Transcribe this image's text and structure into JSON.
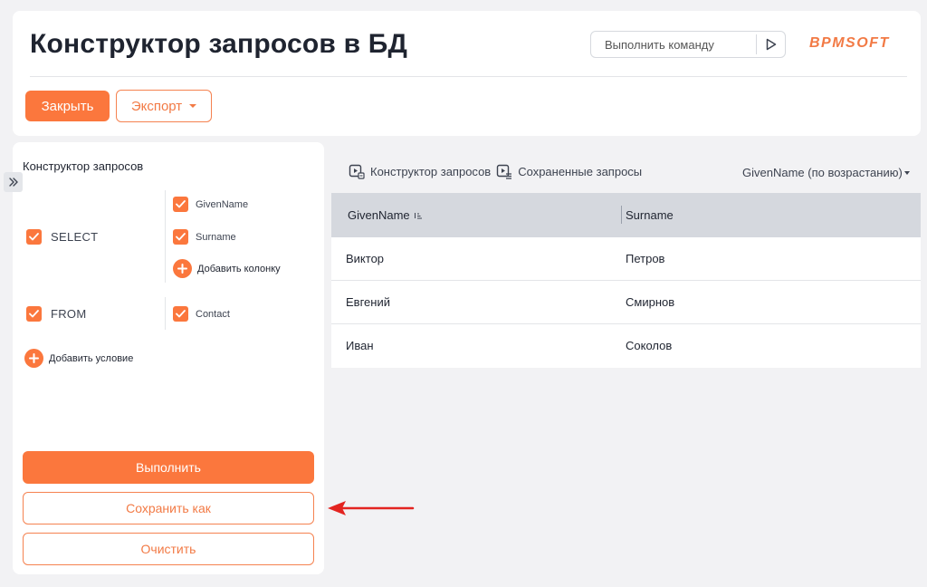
{
  "header": {
    "title": "Конструктор запросов в БД",
    "command_placeholder": "Выполнить команду",
    "logo": "BPMSOFT",
    "close_label": "Закрыть",
    "export_label": "Экспорт"
  },
  "builder": {
    "title": "Конструктор запросов",
    "select_label": "SELECT",
    "select_fields": [
      "GivenName",
      "Surname"
    ],
    "add_column_label": "Добавить колонку",
    "from_label": "FROM",
    "from_table": "Contact",
    "add_condition_label": "Добавить условие",
    "run_label": "Выполнить",
    "save_as_label": "Сохранить как",
    "clear_label": "Очистить"
  },
  "results": {
    "tabs": [
      "Конструктор запросов",
      "Сохраненные запросы"
    ],
    "sort_label": "GivenName (по возрастанию)",
    "columns": [
      "GivenName",
      "Surname"
    ],
    "rows": [
      [
        "Виктор",
        "Петров"
      ],
      [
        "Евгений",
        "Смирнов"
      ],
      [
        "Иван",
        "Соколов"
      ]
    ]
  },
  "colors": {
    "accent": "#fb773d",
    "arrow": "#e32420"
  }
}
